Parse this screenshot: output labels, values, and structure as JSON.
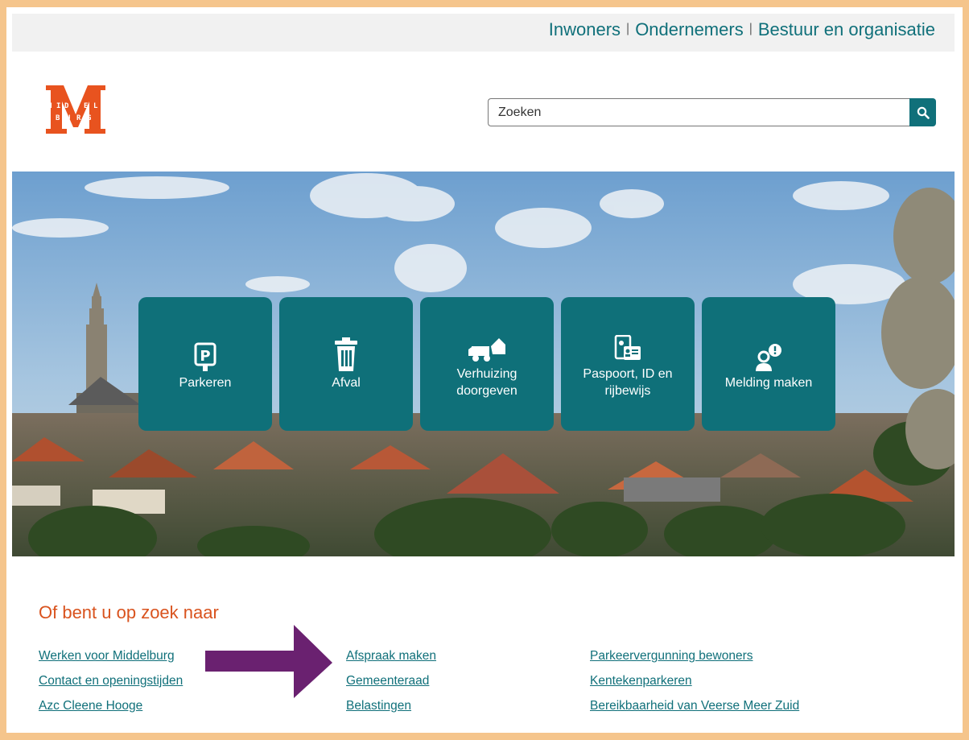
{
  "topnav": {
    "items": [
      "Inwoners",
      "Ondernemers",
      "Bestuur en organisatie"
    ]
  },
  "logo": {
    "letters_top": "MIDDEL",
    "letters_bottom": "BURG",
    "brand_color": "#e8531f"
  },
  "search": {
    "placeholder": "Zoeken",
    "value": ""
  },
  "tiles": [
    {
      "label": "Parkeren",
      "icon": "parking-icon"
    },
    {
      "label": "Afval",
      "icon": "trash-icon"
    },
    {
      "label": "Verhuizing\ndoorgeven",
      "icon": "moving-truck-icon"
    },
    {
      "label": "Paspoort, ID en\nrijbewijs",
      "icon": "id-card-icon"
    },
    {
      "label": "Melding maken",
      "icon": "report-person-icon"
    }
  ],
  "section": {
    "title": "Of bent u op zoek naar"
  },
  "links": {
    "col1": [
      "Werken voor Middelburg",
      "Contact en openingstijden",
      "Azc Cleene Hooge"
    ],
    "col2": [
      "Afspraak maken",
      "Gemeenteraad",
      "Belastingen"
    ],
    "col3": [
      "Parkeervergunning bewoners",
      "Kentekenparkeren",
      "Bereikbaarheid van Veerse Meer Zuid"
    ]
  },
  "colors": {
    "teal": "#0f7079",
    "accent_orange": "#d9531e",
    "arrow_purple": "#6a2170",
    "frame": "#f5c58c"
  }
}
